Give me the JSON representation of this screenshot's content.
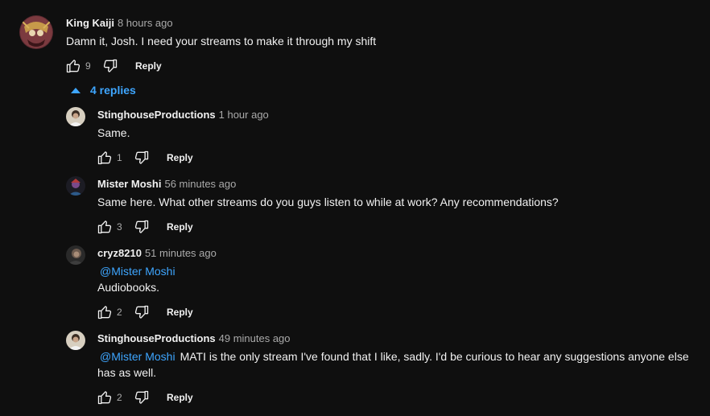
{
  "top_comment": {
    "author": "King Kaiji",
    "time": "8 hours ago",
    "text": "Damn it, Josh. I need your streams to make it through my shift",
    "likes": "9",
    "reply_label": "Reply"
  },
  "replies_toggle": {
    "label": "4 replies"
  },
  "replies": [
    {
      "author": "StinghouseProductions",
      "time": "1 hour ago",
      "mention": "",
      "text": "Same.",
      "likes": "1",
      "reply_label": "Reply"
    },
    {
      "author": "Mister Moshi",
      "time": "56 minutes ago",
      "mention": "",
      "text": "Same here. What other streams do you guys listen to while at work? Any recommendations?",
      "likes": "3",
      "reply_label": "Reply"
    },
    {
      "author": "cryz8210",
      "time": "51 minutes ago",
      "mention": "@Mister Moshi",
      "text": "Audiobooks.",
      "likes": "2",
      "reply_label": "Reply"
    },
    {
      "author": "StinghouseProductions",
      "time": "49 minutes ago",
      "mention": "@Mister Moshi",
      "text": "MATI is the only stream I've found that I like, sadly. I'd be curious to hear any suggestions anyone else has as well.",
      "likes": "2",
      "reply_label": "Reply"
    }
  ],
  "colors": {
    "background": "#0f0f0f",
    "text": "#f1f1f1",
    "secondary_text": "#aaaaaa",
    "link": "#3ea6ff"
  },
  "icons": {
    "like": "thumbs-up-icon",
    "dislike": "thumbs-down-icon",
    "toggle": "caret-up-icon"
  }
}
